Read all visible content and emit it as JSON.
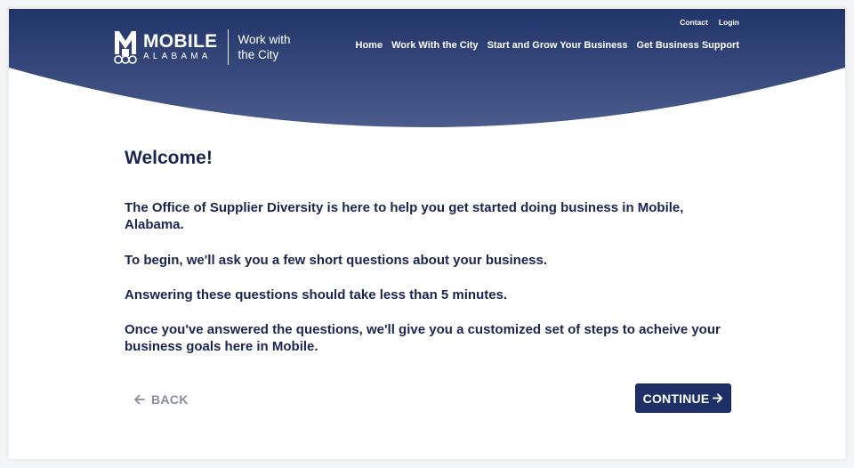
{
  "header": {
    "logo_big": "MOBILE",
    "logo_small": "ALABAMA",
    "tagline": "Work with the City",
    "util_nav": [
      "Contact",
      "Login"
    ],
    "main_nav": [
      "Home",
      "Work With the City",
      "Start and Grow Your Business",
      "Get Business Support"
    ],
    "colors": {
      "top": "#213469",
      "bottom": "#4a5b8c"
    }
  },
  "welcome": {
    "title": "Welcome!",
    "paragraphs": [
      "The Office of Supplier Diversity is here to help you get started doing business in Mobile, Alabama.",
      "To begin, we'll ask you a few short questions about your business.",
      "Answering these questions should take less than 5 minutes.",
      "Once you've answered the questions, we'll give you a customized set of steps to acheive your business goals here in Mobile."
    ]
  },
  "actions": {
    "back_label": "BACK",
    "back_icon": "arrow-left-icon",
    "continue_label": "CONTINUE",
    "continue_icon": "arrow-right-icon",
    "accent": "#1f3066"
  }
}
